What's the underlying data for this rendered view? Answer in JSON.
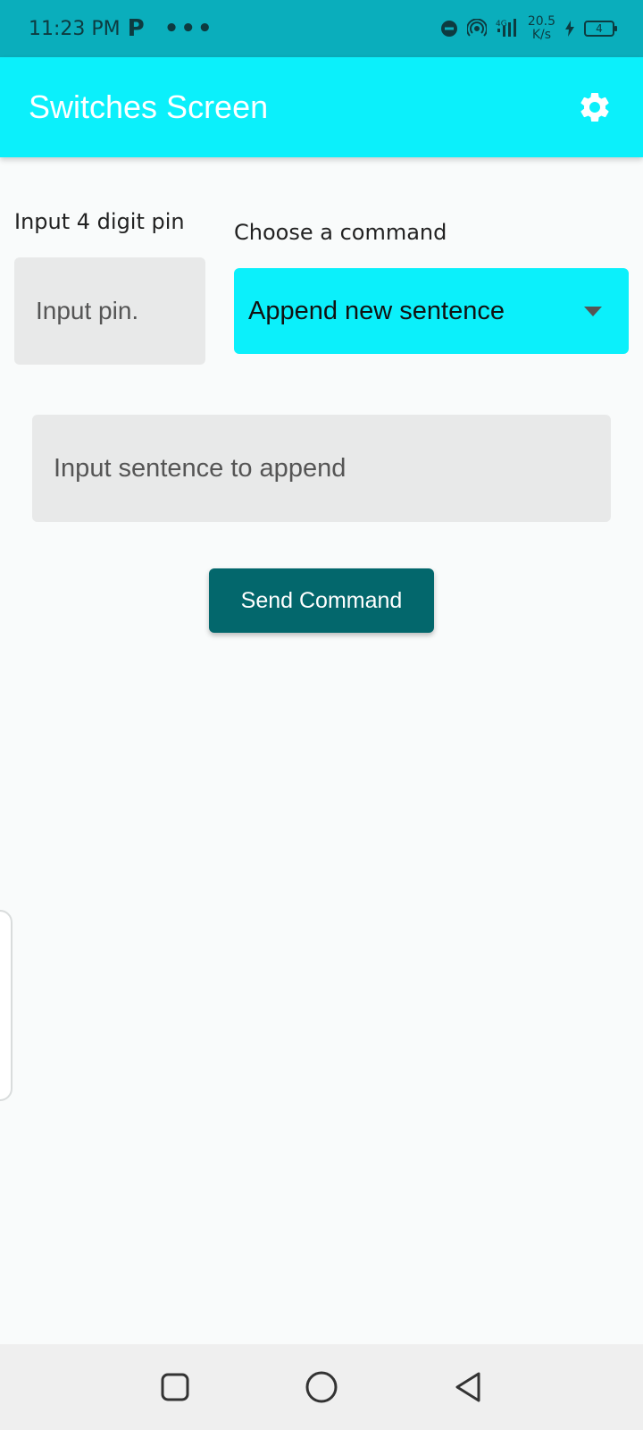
{
  "status_bar": {
    "time": "11:23 PM",
    "app_icon": "P",
    "more_dots": "•••",
    "network": "4G",
    "speed_value": "20.5",
    "speed_unit": "K/s",
    "battery": "4"
  },
  "app_bar": {
    "title": "Switches Screen",
    "settings_icon": "gear-icon"
  },
  "pin": {
    "label": "Input 4 digit pin",
    "placeholder": "Input pin."
  },
  "command": {
    "label": "Choose a command",
    "selected": "Append new sentence"
  },
  "sentence": {
    "placeholder": "Input sentence to append"
  },
  "send_button": {
    "label": "Send Command"
  },
  "colors": {
    "status_bar": "#0aaebc",
    "app_bar": "#0bf0fb",
    "button": "#03676c",
    "input_bg": "#e8e9e9"
  },
  "nav": {
    "recents_icon": "square-icon",
    "home_icon": "circle-icon",
    "back_icon": "triangle-back-icon"
  }
}
